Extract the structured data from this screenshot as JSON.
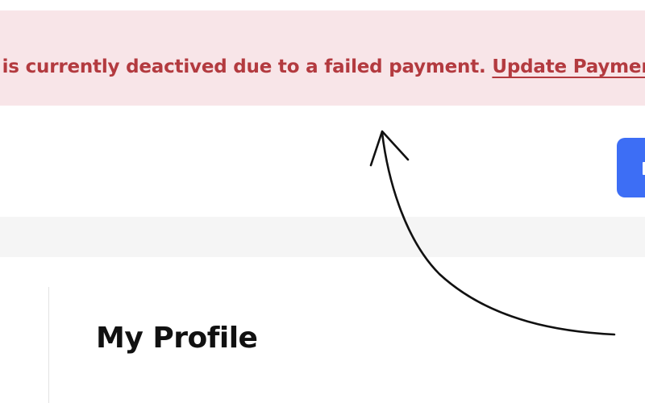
{
  "alert_banner": {
    "message": "t is currently deactived due to a failed payment.",
    "link_label": "Update Payment"
  },
  "profile": {
    "title": "My Profile"
  },
  "colors": {
    "alert_background": "#f8e5e8",
    "alert_text": "#b33a3f",
    "primary_button": "#3d6ef5",
    "section_band": "#f5f5f5",
    "annotation_stroke": "#111111"
  }
}
